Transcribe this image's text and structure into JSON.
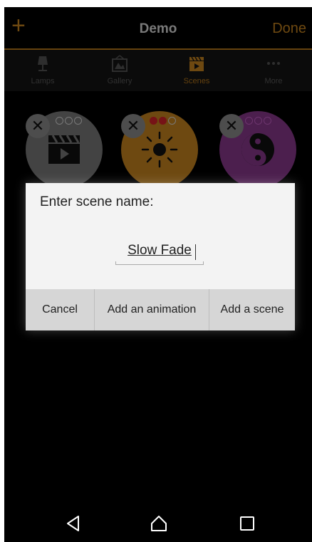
{
  "header": {
    "add_icon": "+",
    "title": "Demo",
    "done_label": "Done"
  },
  "tabs": [
    {
      "label": "Lamps",
      "icon": "lamp-icon",
      "active": false
    },
    {
      "label": "Gallery",
      "icon": "gallery-icon",
      "active": false
    },
    {
      "label": "Scenes",
      "icon": "scenes-icon",
      "active": true
    },
    {
      "label": "More",
      "icon": "more-icon",
      "active": false
    }
  ],
  "scenes": [
    {
      "icon": "clapper-icon",
      "color": "#7a7a7a"
    },
    {
      "icon": "sun-icon",
      "color": "#c9851f"
    },
    {
      "icon": "yin-yang-icon",
      "color": "#8a3a8e"
    }
  ],
  "dialog": {
    "title": "Enter scene name:",
    "input_value": "Slow Fade",
    "buttons": {
      "cancel": "Cancel",
      "add_animation": "Add an animation",
      "add_scene": "Add a scene"
    }
  },
  "colors": {
    "accent": "#c9851f",
    "background": "#000000",
    "dialog": "#f3f3f3"
  }
}
